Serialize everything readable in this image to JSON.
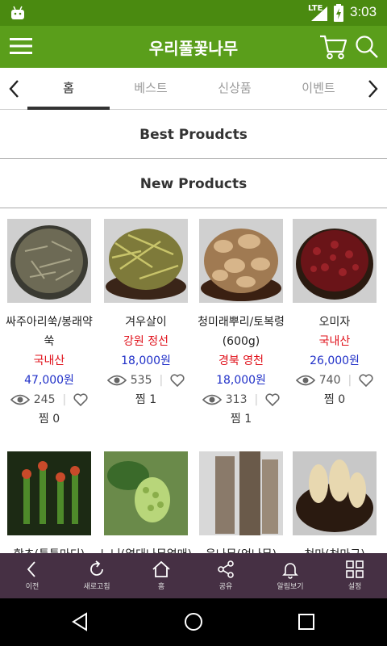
{
  "status": {
    "network": "LTE",
    "time": "3:03"
  },
  "header": {
    "title": "우리풀꽃나무"
  },
  "tabs": [
    "홈",
    "베스트",
    "신상품",
    "이벤트"
  ],
  "sections": {
    "best": "Best Proudcts",
    "new": "New Products"
  },
  "products": [
    {
      "name": "싸주아리쑥/봉래약쑥",
      "origin": "국내산",
      "price": "47,000원",
      "views": "245",
      "jjim": "찜 0"
    },
    {
      "name": "겨우살이",
      "origin": "강원 정선",
      "price": "18,000원",
      "views": "535",
      "jjim": "찜 1"
    },
    {
      "name": "청미래뿌리/토복령(600g)",
      "origin": "경북 영천",
      "price": "18,000원",
      "views": "313",
      "jjim": "찜 1"
    },
    {
      "name": "오미자",
      "origin": "국내산",
      "price": "26,000원",
      "views": "740",
      "jjim": "찜 0"
    },
    {
      "name": "함초(퉁퉁마디)",
      "origin": "",
      "price": "",
      "views": "",
      "jjim": ""
    },
    {
      "name": "노니(열대나무열매)",
      "origin": "",
      "price": "",
      "views": "",
      "jjim": ""
    },
    {
      "name": "음나무(엄나무)",
      "origin": "",
      "price": "",
      "views": "",
      "jjim": ""
    },
    {
      "name": "천마(천마근)",
      "origin": "",
      "price": "",
      "views": "",
      "jjim": ""
    }
  ],
  "toolbar": [
    "이전",
    "새로고침",
    "홈",
    "공유",
    "알림보기",
    "설정"
  ],
  "colors": {
    "status_bar": "#4a8a10",
    "header": "#5a9e1b",
    "toolbar": "#463044",
    "origin": "#e0101a",
    "price": "#2030c8"
  },
  "icons": [
    "android-icon",
    "signal-icon",
    "battery-icon",
    "menu-icon",
    "cart-icon",
    "search-icon",
    "chevron-left-icon",
    "chevron-right-icon",
    "eye-icon",
    "heart-icon",
    "back-icon",
    "refresh-icon",
    "home-icon",
    "share-icon",
    "bell-icon",
    "grid-icon",
    "nav-back-icon",
    "nav-home-icon",
    "nav-recents-icon"
  ]
}
